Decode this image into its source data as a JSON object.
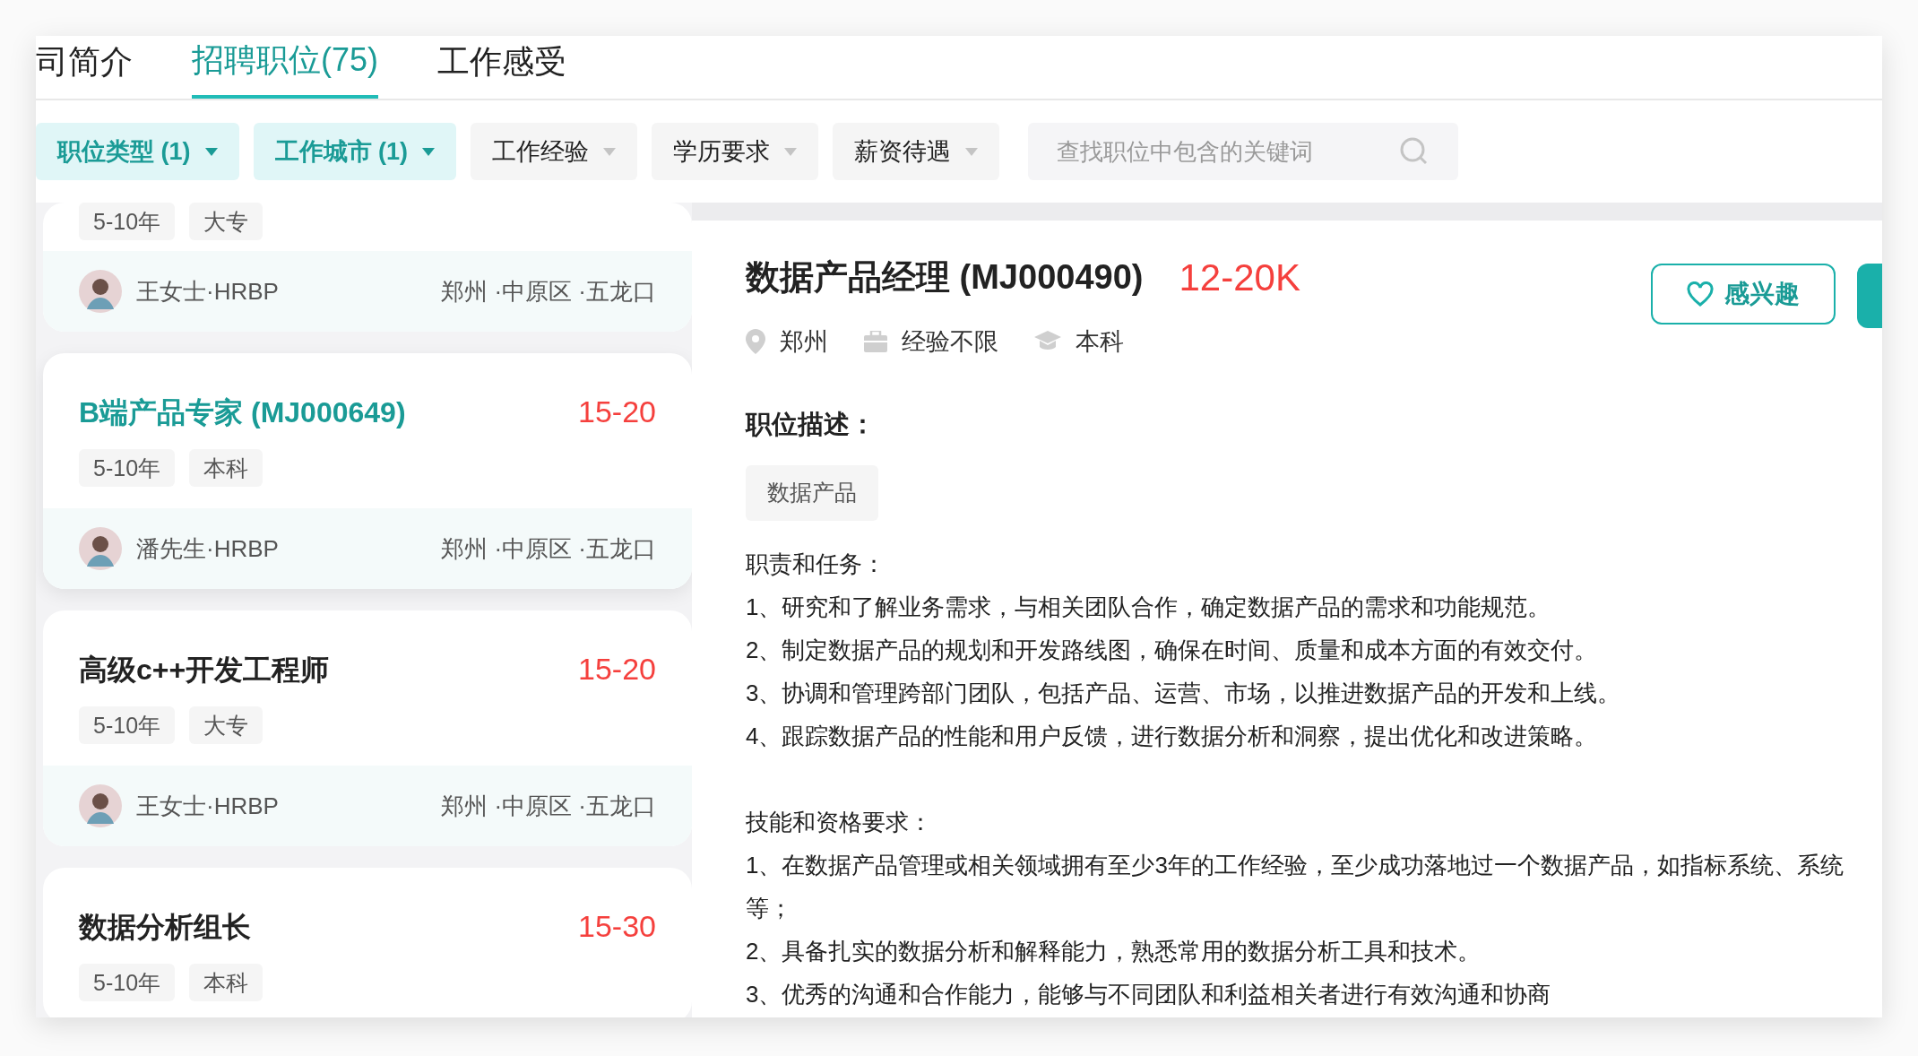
{
  "tabs": [
    {
      "label": "司简介",
      "selected": false
    },
    {
      "label": "招聘职位(75)",
      "selected": true
    },
    {
      "label": "工作感受",
      "selected": false
    }
  ],
  "filters": [
    {
      "label": "职位类型 (1)",
      "active": true
    },
    {
      "label": "工作城市 (1)",
      "active": true
    },
    {
      "label": "工作经验",
      "active": false
    },
    {
      "label": "学历要求",
      "active": false
    },
    {
      "label": "薪资待遇",
      "active": false
    }
  ],
  "search": {
    "placeholder": "查找职位中包含的关键词"
  },
  "jobs": [
    {
      "tags": [
        "5-10年",
        "大专"
      ],
      "recruiter": "王女士·HRBP",
      "location": "郑州 ·中原区 ·五龙口",
      "selected": false
    },
    {
      "title": "B端产品专家 (MJ000649)",
      "salary": "15-20",
      "tags": [
        "5-10年",
        "本科"
      ],
      "recruiter": "潘先生·HRBP",
      "location": "郑州 ·中原区 ·五龙口",
      "selected": true
    },
    {
      "title": "高级c++开发工程师",
      "salary": "15-20",
      "tags": [
        "5-10年",
        "大专"
      ],
      "recruiter": "王女士·HRBP",
      "location": "郑州 ·中原区 ·五龙口",
      "selected": false
    },
    {
      "title": "数据分析组长",
      "salary": "15-30",
      "tags": [
        "5-10年",
        "本科"
      ],
      "selected": false
    }
  ],
  "detail": {
    "title": "数据产品经理 (MJ000490)",
    "salary": "12-20K",
    "meta": [
      {
        "kind": "location",
        "text": "郑州"
      },
      {
        "kind": "experience",
        "text": "经验不限"
      },
      {
        "kind": "education",
        "text": "本科"
      }
    ],
    "interest_button": "感兴趣",
    "section_title": "职位描述：",
    "category_tag": "数据产品",
    "sections": [
      {
        "heading": "职责和任务：",
        "items": [
          "1、研究和了解业务需求，与相关团队合作，确定数据产品的需求和功能规范。",
          "2、制定数据产品的规划和开发路线图，确保在时间、质量和成本方面的有效交付。",
          "3、协调和管理跨部门团队，包括产品、运营、市场，以推进数据产品的开发和上线。",
          "4、跟踪数据产品的性能和用户反馈，进行数据分析和洞察，提出优化和改进策略。"
        ]
      },
      {
        "heading": "技能和资格要求：",
        "items": [
          "1、在数据产品管理或相关领域拥有至少3年的工作经验，至少成功落地过一个数据产品，如指标系统、系统等；",
          "2、具备扎实的数据分析和解释能力，熟悉常用的数据分析工具和技术。",
          "3、优秀的沟通和合作能力，能够与不同团队和利益相关者进行有效沟通和协商"
        ]
      }
    ]
  }
}
